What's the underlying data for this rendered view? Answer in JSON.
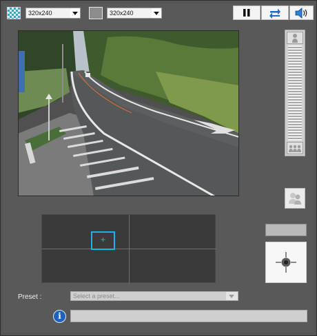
{
  "toolbar": {
    "resolution_left": "320x240",
    "resolution_right": "320x240",
    "pause_icon": "pause-icon",
    "swap_icon": "swap-arrows-icon",
    "sound_icon": "speaker-icon"
  },
  "camera": {
    "description_icon": "live-camera-feed"
  },
  "zoom": {
    "top_icon": "zoom-single-person-icon",
    "bottom_icon": "zoom-group-icon"
  },
  "preset": {
    "label": "Preset :",
    "placeholder": "Select a preset..."
  },
  "info": {
    "icon": "info-icon",
    "message": ""
  },
  "colors": {
    "background": "#595959",
    "accent": "#1ab4ea",
    "button_blue": "#1e63b9"
  }
}
